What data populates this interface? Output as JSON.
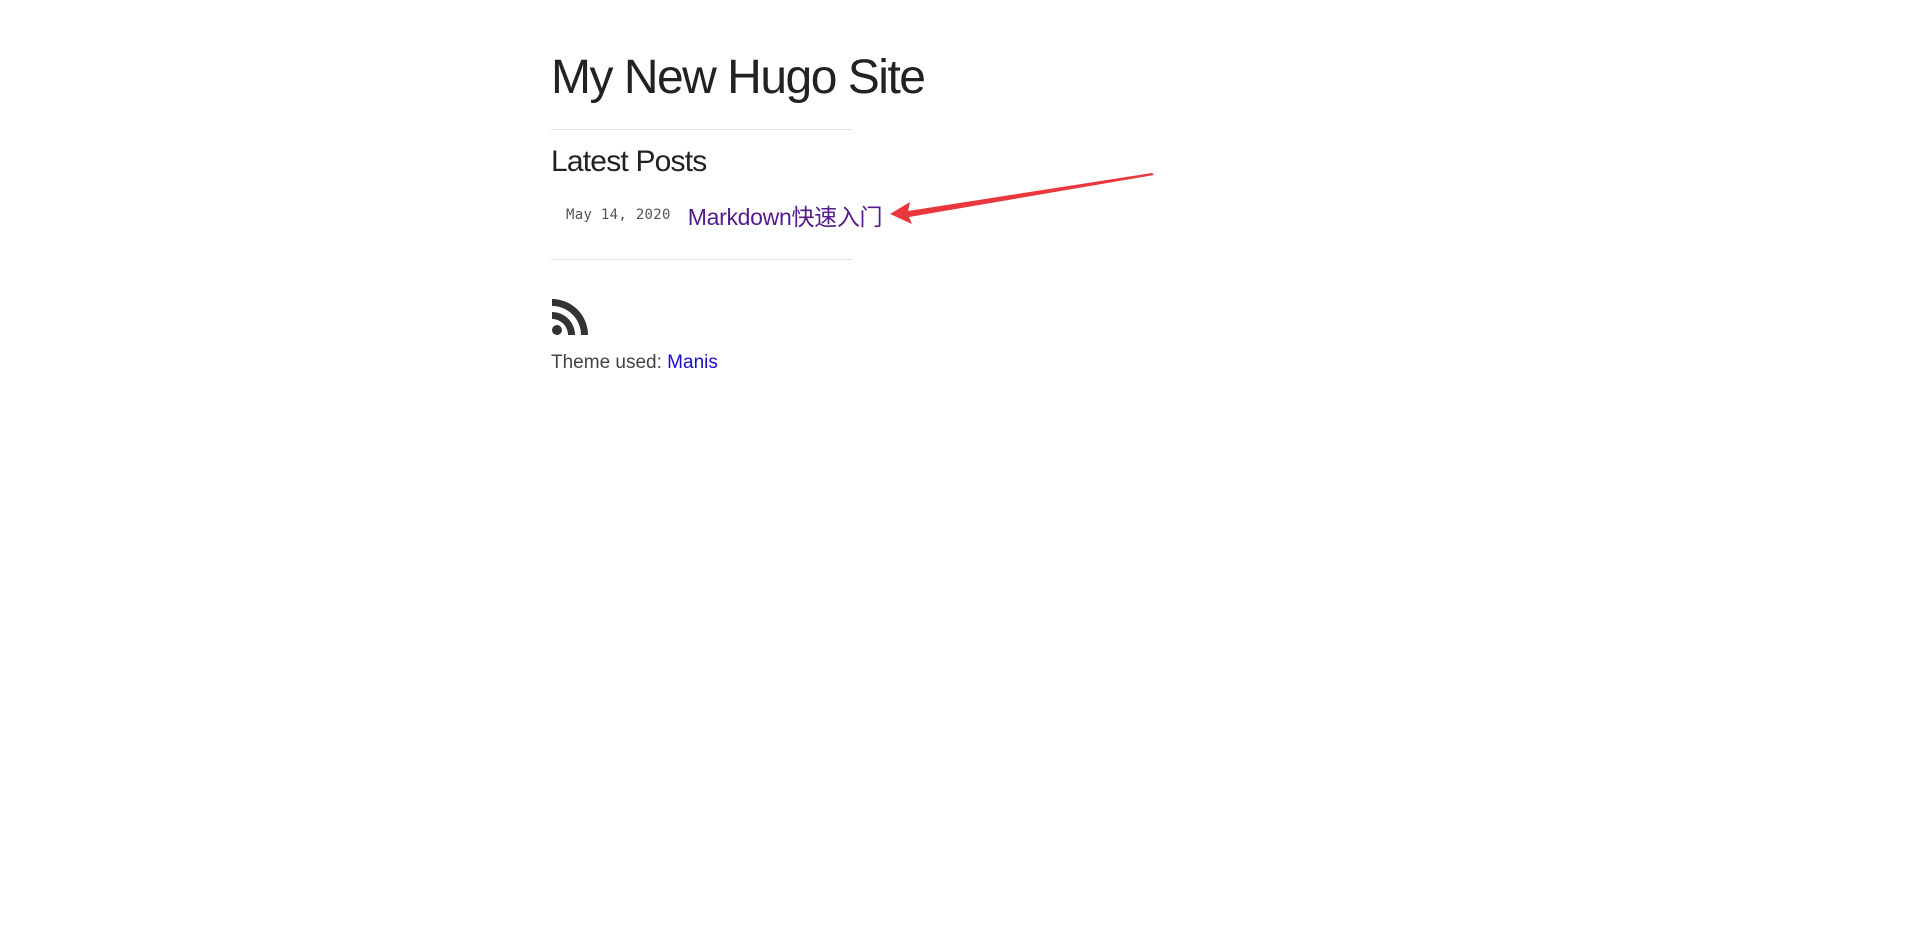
{
  "header": {
    "site_title": "My New Hugo Site"
  },
  "latest_posts": {
    "heading": "Latest Posts",
    "items": [
      {
        "date": "May 14, 2020",
        "title": "Markdown快速入门"
      }
    ]
  },
  "footer": {
    "rss_icon": "rss-icon",
    "theme_prefix": "Theme used: ",
    "theme_name": "Manis"
  },
  "annotation": {
    "arrow_color": "#e8383d"
  },
  "colors": {
    "text": "#222222",
    "visited_link": "#551a8b",
    "link": "#1a0dcc",
    "rule": "#e1e1e1"
  }
}
